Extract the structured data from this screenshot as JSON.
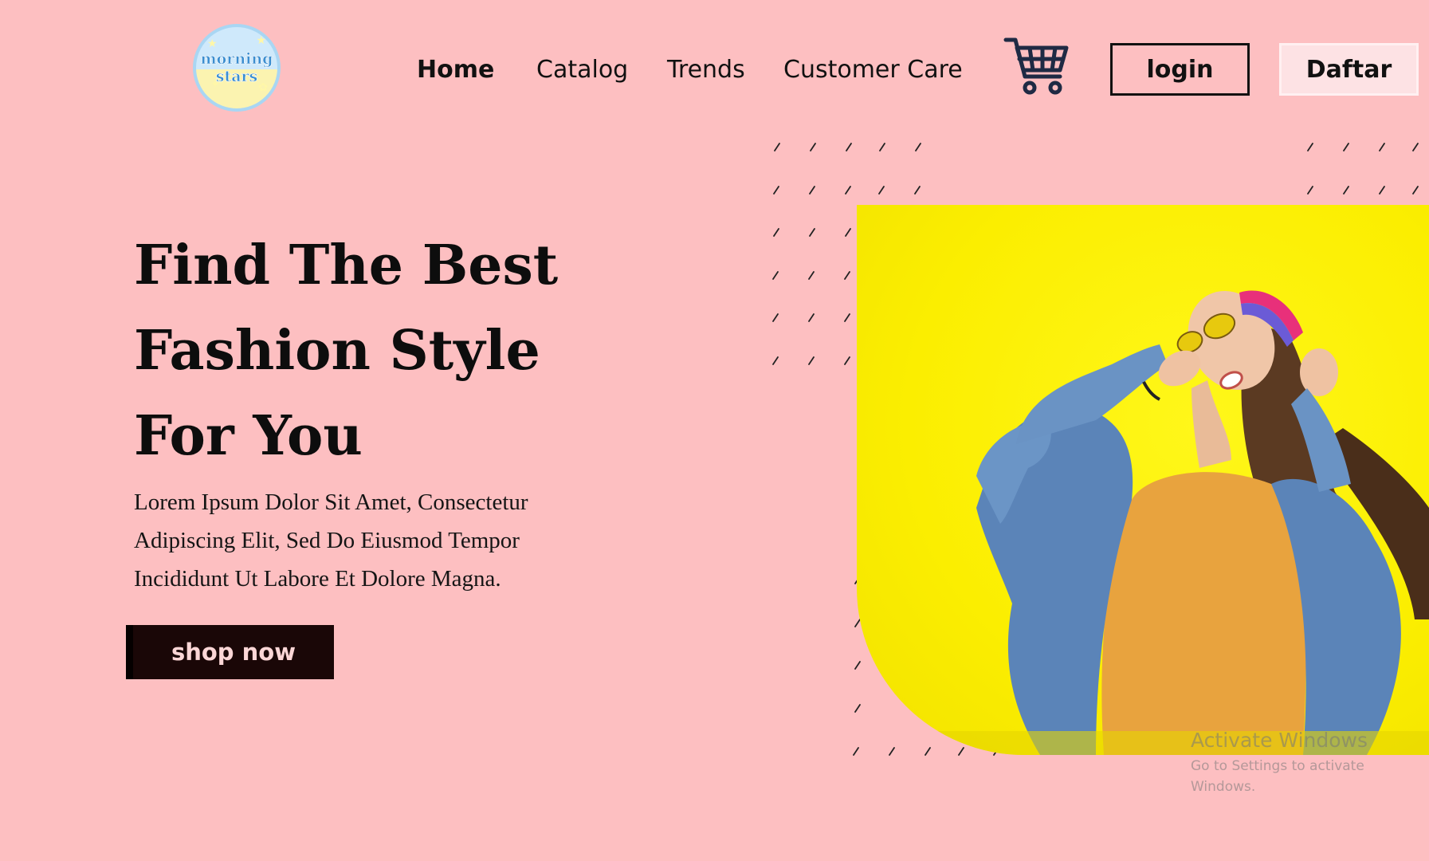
{
  "brand": {
    "logo_line1": "morning",
    "logo_line2": "stars"
  },
  "nav": {
    "home": "Home",
    "catalog": "Catalog",
    "trends": "Trends",
    "customer_care": "Customer Care"
  },
  "header": {
    "cart_icon": "shopping-cart-icon",
    "login": "login",
    "daftar": "Daftar"
  },
  "hero": {
    "headline": [
      "Find The Best",
      "Fashion Style",
      "For You"
    ],
    "description": [
      "Lorem Ipsum Dolor Sit Amet, Consectetur",
      "Adipiscing Elit, Sed Do Eiusmod Tempor",
      "Incididunt Ut Labore Et Dolore Magna."
    ],
    "cta": "shop now"
  },
  "watermark": {
    "title": "Activate Windows",
    "subtitle": "Go to Settings to activate Windows."
  },
  "colors": {
    "background": "#fdbfc1",
    "accent_yellow": "#fbee00",
    "button_dark": "#1a0707",
    "cart": "#1f2a44"
  }
}
